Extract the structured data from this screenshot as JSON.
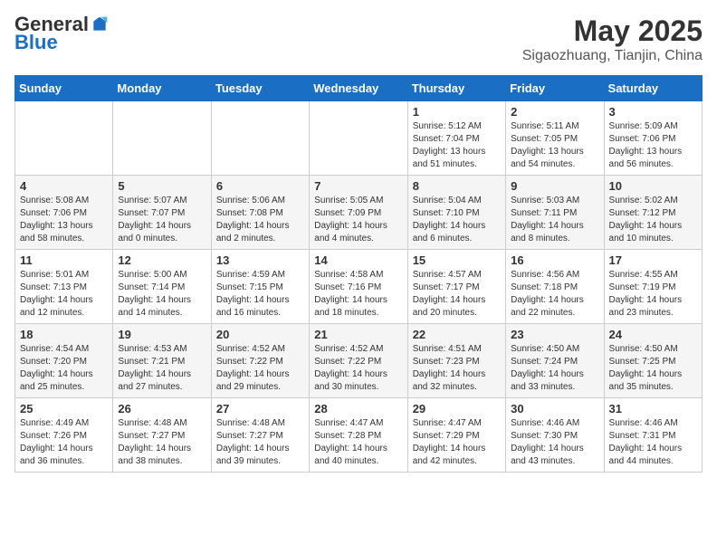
{
  "header": {
    "logo_general": "General",
    "logo_blue": "Blue",
    "month": "May 2025",
    "location": "Sigaozhuang, Tianjin, China"
  },
  "weekdays": [
    "Sunday",
    "Monday",
    "Tuesday",
    "Wednesday",
    "Thursday",
    "Friday",
    "Saturday"
  ],
  "weeks": [
    [
      {
        "day": "",
        "info": ""
      },
      {
        "day": "",
        "info": ""
      },
      {
        "day": "",
        "info": ""
      },
      {
        "day": "",
        "info": ""
      },
      {
        "day": "1",
        "info": "Sunrise: 5:12 AM\nSunset: 7:04 PM\nDaylight: 13 hours and 51 minutes."
      },
      {
        "day": "2",
        "info": "Sunrise: 5:11 AM\nSunset: 7:05 PM\nDaylight: 13 hours and 54 minutes."
      },
      {
        "day": "3",
        "info": "Sunrise: 5:09 AM\nSunset: 7:06 PM\nDaylight: 13 hours and 56 minutes."
      }
    ],
    [
      {
        "day": "4",
        "info": "Sunrise: 5:08 AM\nSunset: 7:06 PM\nDaylight: 13 hours and 58 minutes."
      },
      {
        "day": "5",
        "info": "Sunrise: 5:07 AM\nSunset: 7:07 PM\nDaylight: 14 hours and 0 minutes."
      },
      {
        "day": "6",
        "info": "Sunrise: 5:06 AM\nSunset: 7:08 PM\nDaylight: 14 hours and 2 minutes."
      },
      {
        "day": "7",
        "info": "Sunrise: 5:05 AM\nSunset: 7:09 PM\nDaylight: 14 hours and 4 minutes."
      },
      {
        "day": "8",
        "info": "Sunrise: 5:04 AM\nSunset: 7:10 PM\nDaylight: 14 hours and 6 minutes."
      },
      {
        "day": "9",
        "info": "Sunrise: 5:03 AM\nSunset: 7:11 PM\nDaylight: 14 hours and 8 minutes."
      },
      {
        "day": "10",
        "info": "Sunrise: 5:02 AM\nSunset: 7:12 PM\nDaylight: 14 hours and 10 minutes."
      }
    ],
    [
      {
        "day": "11",
        "info": "Sunrise: 5:01 AM\nSunset: 7:13 PM\nDaylight: 14 hours and 12 minutes."
      },
      {
        "day": "12",
        "info": "Sunrise: 5:00 AM\nSunset: 7:14 PM\nDaylight: 14 hours and 14 minutes."
      },
      {
        "day": "13",
        "info": "Sunrise: 4:59 AM\nSunset: 7:15 PM\nDaylight: 14 hours and 16 minutes."
      },
      {
        "day": "14",
        "info": "Sunrise: 4:58 AM\nSunset: 7:16 PM\nDaylight: 14 hours and 18 minutes."
      },
      {
        "day": "15",
        "info": "Sunrise: 4:57 AM\nSunset: 7:17 PM\nDaylight: 14 hours and 20 minutes."
      },
      {
        "day": "16",
        "info": "Sunrise: 4:56 AM\nSunset: 7:18 PM\nDaylight: 14 hours and 22 minutes."
      },
      {
        "day": "17",
        "info": "Sunrise: 4:55 AM\nSunset: 7:19 PM\nDaylight: 14 hours and 23 minutes."
      }
    ],
    [
      {
        "day": "18",
        "info": "Sunrise: 4:54 AM\nSunset: 7:20 PM\nDaylight: 14 hours and 25 minutes."
      },
      {
        "day": "19",
        "info": "Sunrise: 4:53 AM\nSunset: 7:21 PM\nDaylight: 14 hours and 27 minutes."
      },
      {
        "day": "20",
        "info": "Sunrise: 4:52 AM\nSunset: 7:22 PM\nDaylight: 14 hours and 29 minutes."
      },
      {
        "day": "21",
        "info": "Sunrise: 4:52 AM\nSunset: 7:22 PM\nDaylight: 14 hours and 30 minutes."
      },
      {
        "day": "22",
        "info": "Sunrise: 4:51 AM\nSunset: 7:23 PM\nDaylight: 14 hours and 32 minutes."
      },
      {
        "day": "23",
        "info": "Sunrise: 4:50 AM\nSunset: 7:24 PM\nDaylight: 14 hours and 33 minutes."
      },
      {
        "day": "24",
        "info": "Sunrise: 4:50 AM\nSunset: 7:25 PM\nDaylight: 14 hours and 35 minutes."
      }
    ],
    [
      {
        "day": "25",
        "info": "Sunrise: 4:49 AM\nSunset: 7:26 PM\nDaylight: 14 hours and 36 minutes."
      },
      {
        "day": "26",
        "info": "Sunrise: 4:48 AM\nSunset: 7:27 PM\nDaylight: 14 hours and 38 minutes."
      },
      {
        "day": "27",
        "info": "Sunrise: 4:48 AM\nSunset: 7:27 PM\nDaylight: 14 hours and 39 minutes."
      },
      {
        "day": "28",
        "info": "Sunrise: 4:47 AM\nSunset: 7:28 PM\nDaylight: 14 hours and 40 minutes."
      },
      {
        "day": "29",
        "info": "Sunrise: 4:47 AM\nSunset: 7:29 PM\nDaylight: 14 hours and 42 minutes."
      },
      {
        "day": "30",
        "info": "Sunrise: 4:46 AM\nSunset: 7:30 PM\nDaylight: 14 hours and 43 minutes."
      },
      {
        "day": "31",
        "info": "Sunrise: 4:46 AM\nSunset: 7:31 PM\nDaylight: 14 hours and 44 minutes."
      }
    ]
  ]
}
